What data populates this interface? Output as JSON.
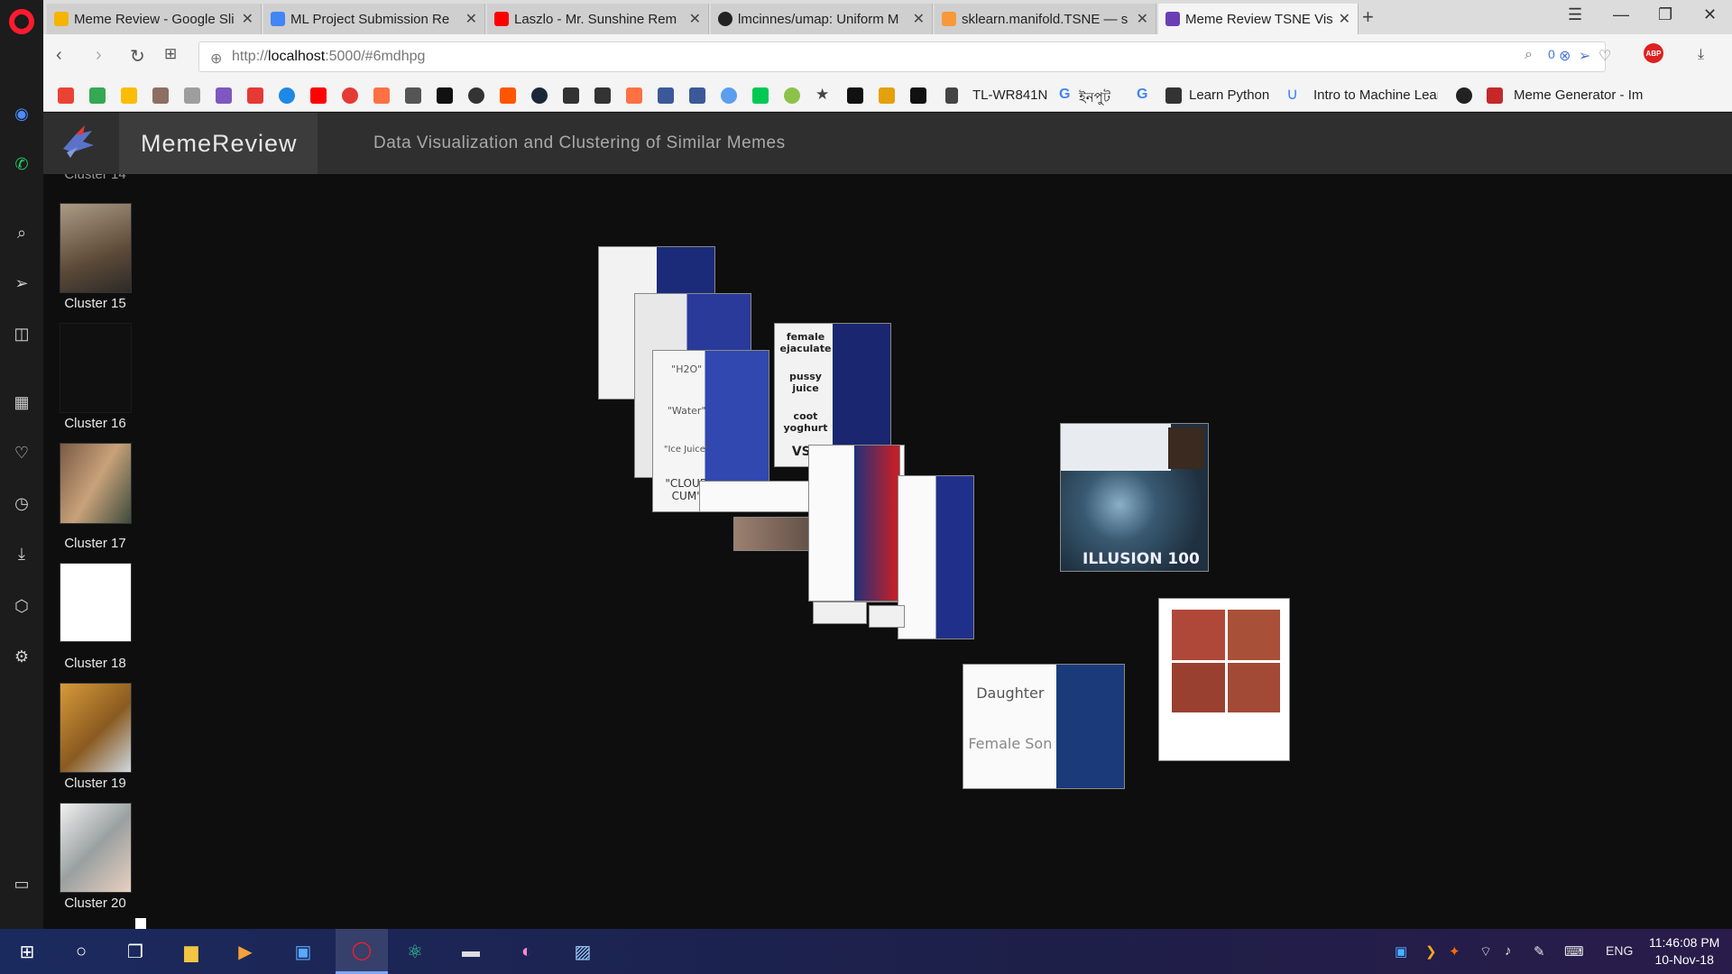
{
  "browser": {
    "tabs": [
      {
        "title": "Meme Review - Google Sli",
        "favicon_color": "#f4b400"
      },
      {
        "title": "ML Project Submission Re",
        "favicon_color": "#4285f4"
      },
      {
        "title": "Laszlo - Mr. Sunshine Rem",
        "favicon_color": "#ff0000"
      },
      {
        "title": "lmcinnes/umap: Uniform M",
        "favicon_color": "#222222"
      },
      {
        "title": "sklearn.manifold.TSNE — s",
        "favicon_color": "#f89939"
      },
      {
        "title": "Meme Review TSNE Visual",
        "favicon_color": "#6a3fb5",
        "active": true
      }
    ],
    "url_prefix": "http://",
    "url_host": "localhost",
    "url_rest": ":5000/#6mdhpg",
    "badge_count": "0",
    "bookmarks": [
      {
        "icon": "gmail-icon",
        "color": "#ea4335"
      },
      {
        "icon": "google-drive-icon",
        "color": "#34a853"
      },
      {
        "icon": "bookmark-icon",
        "color": "#fbbc05"
      },
      {
        "icon": "bookmark-icon",
        "color": "#8d6e63"
      },
      {
        "icon": "bookmark-icon",
        "color": "#9e9e9e"
      },
      {
        "icon": "bookmark-icon",
        "color": "#7e57c2"
      },
      {
        "icon": "x-icon",
        "color": "#e53935"
      },
      {
        "icon": "bookmark-icon",
        "color": "#1e88e5"
      },
      {
        "icon": "youtube-icon",
        "color": "#ff0000"
      },
      {
        "icon": "bookmark-icon",
        "color": "#e53935"
      },
      {
        "icon": "bookmark-icon",
        "color": "#ff7043"
      },
      {
        "icon": "bookmark-icon",
        "color": "#555555"
      },
      {
        "icon": "bookmark-icon",
        "color": "#111111"
      },
      {
        "icon": "bookmark-icon",
        "color": "#333333"
      },
      {
        "icon": "soundcloud-icon",
        "color": "#ff5500"
      },
      {
        "icon": "steam-icon",
        "color": "#1b2838"
      },
      {
        "icon": "bookmark-icon",
        "color": "#333333"
      },
      {
        "icon": "bookmark-icon",
        "color": "#333333"
      },
      {
        "icon": "bookmark-icon",
        "color": "#ff7043"
      },
      {
        "icon": "facebook-icon",
        "color": "#3b5998"
      },
      {
        "icon": "facebook-icon",
        "color": "#3b5998"
      },
      {
        "icon": "bookmark-icon",
        "color": "#5c9ded"
      },
      {
        "icon": "play-store-icon",
        "color": "#00c853"
      },
      {
        "icon": "bookmark-icon",
        "color": "#8bc34a"
      },
      {
        "icon": "star-icon",
        "color": "#444444"
      },
      {
        "icon": "bookmark-icon",
        "color": "#111111"
      },
      {
        "icon": "plex-icon",
        "color": "#e5a00d"
      },
      {
        "icon": "bookmark-icon",
        "color": "#111111"
      }
    ],
    "bookmark_labels": [
      "TL-WR841N",
      "ইনপুট",
      "Learn Python",
      "Intro to Machine Lear",
      "Meme Generator - Im"
    ]
  },
  "app": {
    "brand": "MemeReview",
    "subtitle": "Data Visualization and Clustering of Similar Memes",
    "clusters": [
      {
        "label": "Cluster 15",
        "thumb": "#7a6a55"
      },
      {
        "label": "Cluster 16",
        "thumb": "#101010"
      },
      {
        "label": "Cluster 17",
        "thumb": "#8a6a50"
      },
      {
        "label": "Cluster 18",
        "thumb": "#ffffff"
      },
      {
        "label": "Cluster 19",
        "thumb": "#b87a2a"
      },
      {
        "label": "Cluster 20",
        "thumb": "#e8e8e8"
      }
    ],
    "meme_texts": {
      "h2o": "\"H2O\"",
      "water": "\"Water\"",
      "ice_juice": "\"Ice Juice\"",
      "cloud_cum": "\"CLOUD CUM\"",
      "female_ejaculate": "female ejaculate",
      "pussy_juice": "pussy juice",
      "coot_yoghurt": "coot yoghurt",
      "vsa": "VSa",
      "daughter": "Daughter",
      "female_son": "Female Son",
      "illusion": "ILLUSION 100"
    }
  },
  "taskbar": {
    "lang": "ENG",
    "time": "11:46:08 PM",
    "date": "10-Nov-18"
  }
}
